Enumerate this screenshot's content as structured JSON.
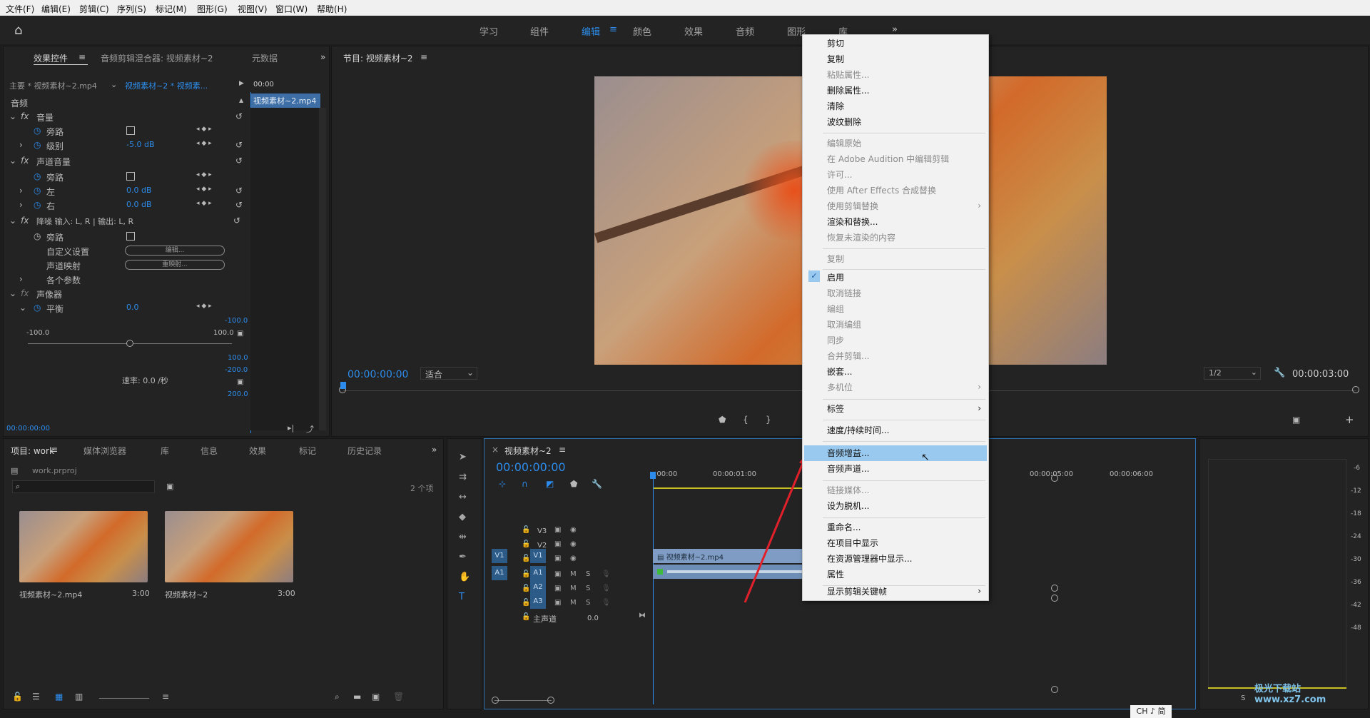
{
  "menubar": [
    "文件(F)",
    "编辑(E)",
    "剪辑(C)",
    "序列(S)",
    "标记(M)",
    "图形(G)",
    "视图(V)",
    "窗口(W)",
    "帮助(H)"
  ],
  "workspaces": [
    "学习",
    "组件",
    "编辑",
    "颜色",
    "效果",
    "音频",
    "图形",
    "库"
  ],
  "effect_panel": {
    "tabs": [
      "效果控件",
      "音频剪辑混合器: 视频素材~2",
      "元数据"
    ],
    "source": "主要 * 视频素材~2.mp4",
    "target": "视频素材~2 * 视频素...",
    "timecode_head": "00:00",
    "clip_label": "视频素材~2.mp4",
    "section": "音频",
    "rows": {
      "volume": "音量",
      "bypass": "旁路",
      "level": "级别",
      "level_val": "-5.0 dB",
      "channel_vol": "声道音量",
      "left": "左",
      "left_val": "0.0 dB",
      "right": "右",
      "right_val": "0.0 dB",
      "denoise": "降噪 输入: L, R | 输出: L, R",
      "custom": "自定义设置",
      "edit_btn": "编辑...",
      "channel_map": "声道映射",
      "remap_btn": "重映射...",
      "params": "各个参数",
      "panner": "声像器",
      "balance": "平衡",
      "balance_val": "0.0",
      "min": "-100.0",
      "max": "100.0",
      "r1": "-100.0",
      "r2": "100.0",
      "r3": "-200.0",
      "r4": "200.0",
      "rate": "速率: 0.0 /秒"
    },
    "footer_tc": "00:00:00:00"
  },
  "program": {
    "title": "节目: 视频素材~2",
    "timecode": "00:00:00:00",
    "fit": "适合",
    "ratio": "1/2",
    "duration": "00:00:03:00"
  },
  "project": {
    "tabs": [
      "项目: work",
      "媒体浏览器",
      "库",
      "信息",
      "效果",
      "标记",
      "历史记录"
    ],
    "file": "work.prproj",
    "count": "2 个项",
    "items": [
      {
        "name": "视频素材~2.mp4",
        "dur": "3:00"
      },
      {
        "name": "视频素材~2",
        "dur": "3:00"
      }
    ]
  },
  "timeline": {
    "title": "视频素材~2",
    "timecode": "00:00:00:00",
    "ruler": [
      ":00:00",
      "00:00:01:00",
      "00:00:05:00",
      "00:00:06:00"
    ],
    "tracks_v": [
      "V3",
      "V2",
      "V1"
    ],
    "tracks_a": [
      "A1",
      "A2",
      "A3"
    ],
    "master": "主声道",
    "master_val": "0.0",
    "clip": "视频素材~2.mp4",
    "meter_ticks": [
      "-6",
      "-12",
      "-18",
      "-24",
      "-30",
      "-36",
      "-42",
      "-48"
    ],
    "meter_s": "S"
  },
  "context_menu": [
    {
      "label": "剪切",
      "enabled": true
    },
    {
      "label": "复制",
      "enabled": true
    },
    {
      "label": "粘贴属性...",
      "enabled": false
    },
    {
      "label": "删除属性...",
      "enabled": true
    },
    {
      "label": "清除",
      "enabled": true
    },
    {
      "label": "波纹删除",
      "enabled": true
    },
    {
      "label": "编辑原始",
      "enabled": false
    },
    {
      "label": "在 Adobe Audition 中编辑剪辑",
      "enabled": false
    },
    {
      "label": "许可...",
      "enabled": false
    },
    {
      "label": "使用 After Effects 合成替换",
      "enabled": false
    },
    {
      "label": "使用剪辑替换",
      "enabled": false
    },
    {
      "label": "渲染和替换...",
      "enabled": true
    },
    {
      "label": "恢复未渲染的内容",
      "enabled": false
    },
    {
      "label": "复制",
      "enabled": false
    },
    {
      "label": "启用",
      "enabled": true
    },
    {
      "label": "取消链接",
      "enabled": false
    },
    {
      "label": "编组",
      "enabled": false
    },
    {
      "label": "取消编组",
      "enabled": false
    },
    {
      "label": "同步",
      "enabled": false
    },
    {
      "label": "合并剪辑...",
      "enabled": false
    },
    {
      "label": "嵌套...",
      "enabled": true
    },
    {
      "label": "多机位",
      "enabled": false
    },
    {
      "label": "标签",
      "enabled": true
    },
    {
      "label": "速度/持续时间...",
      "enabled": true
    },
    {
      "label": "音频增益...",
      "enabled": true
    },
    {
      "label": "音频声道...",
      "enabled": true
    },
    {
      "label": "链接媒体...",
      "enabled": false
    },
    {
      "label": "设为脱机...",
      "enabled": true
    },
    {
      "label": "重命名...",
      "enabled": true
    },
    {
      "label": "在项目中显示",
      "enabled": true
    },
    {
      "label": "在资源管理器中显示...",
      "enabled": true
    },
    {
      "label": "属性",
      "enabled": true
    },
    {
      "label": "显示剪辑关键帧",
      "enabled": true
    }
  ],
  "ime": "CH ♪ 简",
  "watermark": "极光下载站 www.xz7.com",
  "colors": {
    "accent": "#2d8ceb",
    "menu_hl": "#99c9ef",
    "arrow": "#e0202a"
  }
}
